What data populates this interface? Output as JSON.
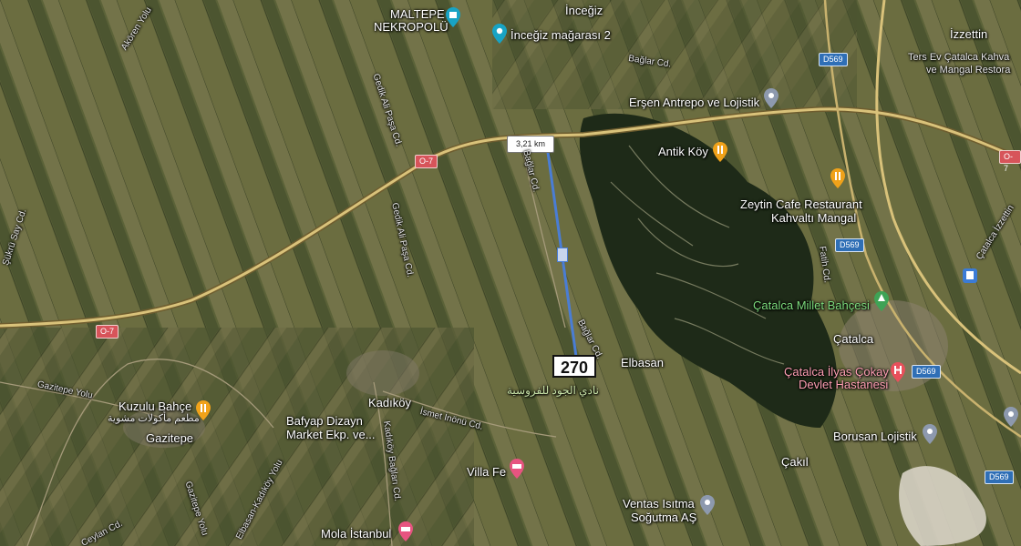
{
  "map": {
    "measurement": {
      "distance_label": "3,21 km"
    },
    "marker": {
      "label": "270"
    },
    "places": {
      "maltepe_1": "MALTEPE",
      "maltepe_2": "NEKROPOLÜ",
      "inceğiz": "İnceğiz",
      "inceğiz_cave": "İnceğiz mağarası 2",
      "izzettin": "İzzettin",
      "ters_ev_1": "Ters Ev Çatalca Kahva",
      "ters_ev_2": "ve Mangal Restora",
      "ersen": "Erşen Antrepo ve Lojistik",
      "antik_koy": "Antik Köy",
      "zeytin_1": "Zeytin Cafe Restaurant",
      "zeytin_2": "Kahvaltı Mangal",
      "millet_bahcesi": "Çatalca Millet Bahçesi",
      "catalca": "Çatalca",
      "hastane_1": "Çatalca İlyas Çokay",
      "hastane_2": "Devlet Hastanesi",
      "borusan": "Borusan Lojistik",
      "cakil": "Çakıl",
      "elbasan": "Elbasan",
      "kadikoy": "Kadıköy",
      "kuzulu": "Kuzulu Bahçe",
      "kuzulu_ar": "مطعم مأكولات مشوية",
      "gazitepe": "Gazitepe",
      "bafyap_1": "Bafyap Dizayn",
      "bafyap_2": "Market Ekp. ve...",
      "villa": "Villa Fe",
      "ventas_1": "Ventas Isıtma",
      "ventas_2": "Soğutma AŞ",
      "mola": "Mola İstanbul",
      "arabic_club": "نادي الجود للفروسية"
    },
    "roads": {
      "akoren": "Akören Yolu",
      "gedik_1": "Gedik Ali Paşa Cd.",
      "gedik_2": "Gedik Ali Paşa Cd.",
      "baglar_top": "Bağlar Cd.",
      "baglar_mid": "Bağlar Cd.",
      "baglar_low": "Bağlar Cd.",
      "ismet": "İsmet İnönü Cd.",
      "kadikoy_baglar": "Kadıköy Bağları Cd.",
      "elbasan_kadikoy": "Elbasan-Kadıköy Yolu",
      "gazitepe_yolu": "Gazitepe Yolu",
      "gazitepe_yolu_2": "Gazitepe Yolu",
      "fatih": "Fatih Cd.",
      "izzettin_cd": "Çatalca İzzettin",
      "say_cd": "Şükrü Say Cd.",
      "cevlan": "Ceylan Cd."
    },
    "shields": {
      "d569_a": "D569",
      "d569_b": "D569",
      "d569_c": "D569",
      "d569_d": "D569",
      "o7_a": "O-7",
      "o7_b": "O-7",
      "o7_c": "O-7"
    },
    "colors": {
      "measure_line": "#4a7dd4",
      "highway": "#d9c27a",
      "forest": "#1e2a18"
    }
  }
}
